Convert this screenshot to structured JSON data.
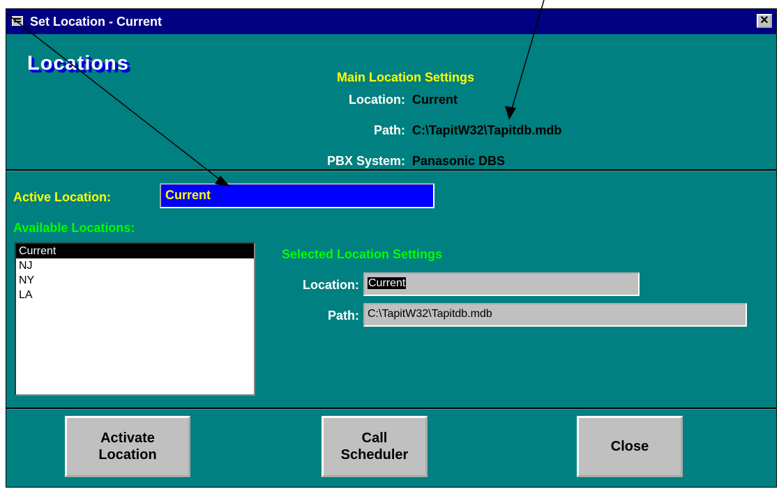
{
  "window": {
    "title": "Set Location -  Current",
    "close_glyph": "✕"
  },
  "heading": "Locations",
  "main_settings": {
    "header": "Main Location Settings",
    "location_label": "Location:",
    "location_value": "Current",
    "path_label": "Path:",
    "path_value": "C:\\TapitW32\\Tapitdb.mdb",
    "pbx_label": "PBX System:",
    "pbx_value": "Panasonic DBS"
  },
  "active": {
    "label": "Active Location:",
    "value": "Current"
  },
  "available": {
    "label": "Available Locations:",
    "items": [
      "Current",
      "NJ",
      "NY",
      "LA"
    ],
    "selected_index": 0
  },
  "selected_settings": {
    "header": "Selected Location Settings",
    "location_label": "Location:",
    "location_value": "Current",
    "path_label": "Path:",
    "path_value": "C:\\TapitW32\\Tapitdb.mdb"
  },
  "buttons": {
    "activate": "Activate\nLocation",
    "scheduler": "Call\nScheduler",
    "close": "Close"
  },
  "icons": {
    "system": "form-icon",
    "close": "close-icon"
  }
}
